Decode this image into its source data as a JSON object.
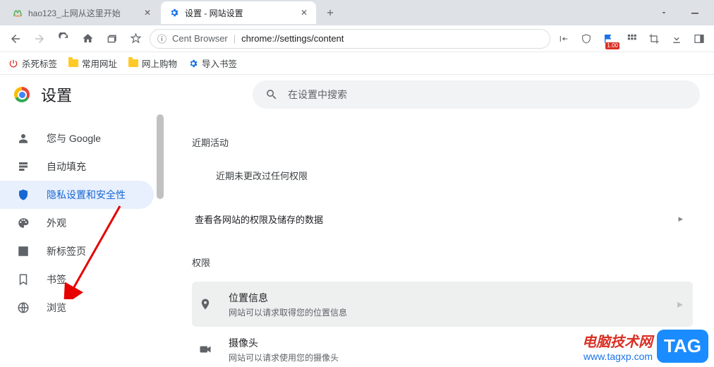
{
  "tabs": [
    {
      "title": "hao123_上网从这里开始"
    },
    {
      "title": "设置 - 网站设置"
    }
  ],
  "omnibox": {
    "info_icon": "ⓘ",
    "host_label": "Cent Browser",
    "url": "chrome://settings/content"
  },
  "toolbar_badge": "1.00",
  "bookmarks": [
    {
      "label": "杀死标签",
      "icon": "power"
    },
    {
      "label": "常用网址",
      "icon": "folder"
    },
    {
      "label": "网上购物",
      "icon": "folder"
    },
    {
      "label": "导入书签",
      "icon": "gear"
    }
  ],
  "settings": {
    "title": "设置",
    "search_placeholder": "在设置中搜索",
    "nav": [
      {
        "label": "您与 Google"
      },
      {
        "label": "自动填充"
      },
      {
        "label": "隐私设置和安全性"
      },
      {
        "label": "外观"
      },
      {
        "label": "新标签页"
      },
      {
        "label": "书签"
      },
      {
        "label": "浏览"
      }
    ],
    "recent": {
      "heading": "近期活动",
      "empty": "近期未更改过任何权限"
    },
    "all_sites_row": "查看各网站的权限及储存的数据",
    "permissions_heading": "权限",
    "perms": [
      {
        "title": "位置信息",
        "desc": "网站可以请求取得您的位置信息"
      },
      {
        "title": "摄像头",
        "desc": "网站可以请求使用您的摄像头"
      }
    ]
  },
  "watermark": {
    "line1": "电脑技术网",
    "line2": "www.tagxp.com",
    "tag": "TAG"
  }
}
